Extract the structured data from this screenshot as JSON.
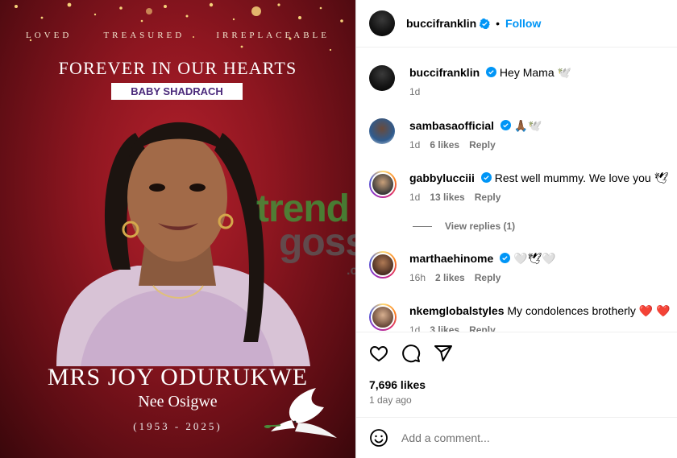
{
  "poster": {
    "words": [
      "LOVED",
      "TREASURED",
      "IRREPLACEABLE"
    ],
    "title": "FOREVER IN OUR HEARTS",
    "tag": "BABY SHADRACH",
    "name": "MRS JOY ODURUKWE",
    "nee": "Nee Osigwe",
    "years": "(1953 - 2025)",
    "watermark": {
      "line1": "trend",
      "line2": "goss",
      "suffix": ".com"
    }
  },
  "header": {
    "username": "buccifranklin",
    "dot": "•",
    "follow_label": "Follow"
  },
  "comments": [
    {
      "user": "buccifranklin",
      "text": "Hey Mama 🕊️",
      "time": "1d",
      "likes": "",
      "reply": "",
      "avatar": "dark"
    },
    {
      "user": "sambasaofficial",
      "text": "🙏🏾🕊️",
      "time": "1d",
      "likes": "6 likes",
      "reply": "Reply",
      "avatar": "samba"
    },
    {
      "user": "gabbylucciii",
      "text": "Rest well mummy. We love you 🕊",
      "time": "1d",
      "likes": "13 likes",
      "reply": "Reply",
      "avatar": "gabby"
    },
    {
      "user": "marthaehinome",
      "text": "🤍🕊🤍",
      "time": "16h",
      "likes": "2 likes",
      "reply": "Reply",
      "avatar": "martha"
    },
    {
      "user": "nkemglobalstyles",
      "text": "My condolences brotherly ❤️ ❤️",
      "time": "1d",
      "likes": "3 likes",
      "reply": "Reply",
      "avatar": "nkem"
    }
  ],
  "view_replies": "View replies (1)",
  "actions": {
    "likes": "7,696 likes",
    "time": "1 day ago"
  },
  "add_comment": {
    "placeholder": "Add a comment..."
  },
  "colors": {
    "accent": "#0095f6",
    "verified": "#0095f6",
    "muted": "#737373",
    "poster_red": "#8e1620",
    "tag_purple": "#4b2a7b"
  },
  "icons": [
    "heart-icon",
    "comment-icon",
    "share-icon",
    "save-icon",
    "emoji-icon",
    "verified-icon",
    "dove-icon"
  ]
}
